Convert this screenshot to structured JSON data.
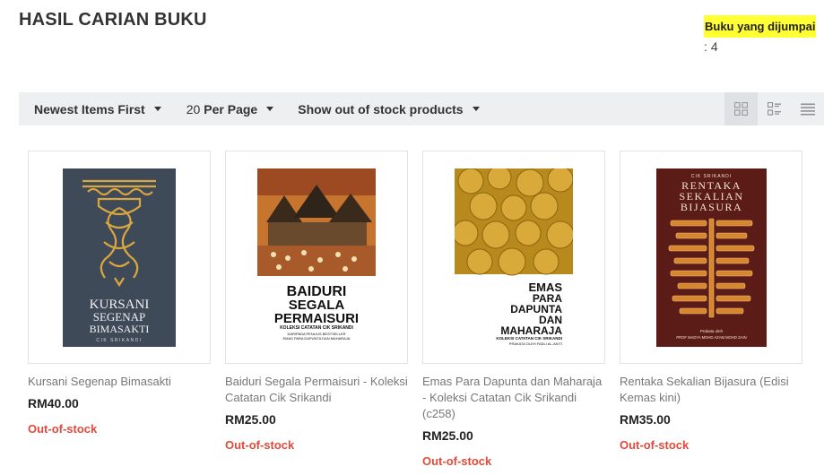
{
  "header": {
    "title": "HASIL CARIAN BUKU",
    "found_label": "Buku yang dijumpai",
    "found_count_prefix": ":",
    "found_count": "4"
  },
  "toolbar": {
    "sort_label": "Newest Items First",
    "per_page_number": "20",
    "per_page_label": "Per Page",
    "stock_label": "Show out of stock products",
    "views": [
      "grid-large-icon",
      "grid-list-icon",
      "list-icon"
    ],
    "active_view": "grid-large-icon"
  },
  "products": [
    {
      "name": "Kursani Segenap Bimasakti",
      "price": "RM40.00",
      "stock": "Out-of-stock",
      "cover": {
        "line1": "KURSANI",
        "line2": "SEGENAP",
        "line3": "BIMASAKTI",
        "sub": "CIK SRIKANDI"
      }
    },
    {
      "name": "Baiduri Segala Permaisuri - Koleksi Catatan Cik Srikandi",
      "price": "RM25.00",
      "stock": "Out-of-stock",
      "cover": {
        "line1": "BAIDURI",
        "line2": "SEGALA",
        "line3": "PERMAISURI",
        "sub": "KOLEKSI CATATAN CIK SRIKANDI",
        "sub2": "DARIPADA PENULIS BESTSELLER",
        "sub3": "EMAS PARA DAPUNTA DAN MAHARAJA"
      }
    },
    {
      "name": "Emas Para Dapunta dan Maharaja - Koleksi Catatan Cik Srikandi (c258)",
      "price": "RM25.00",
      "stock": "Out-of-stock",
      "cover": {
        "line1": "EMAS",
        "line2": "PARA",
        "line3": "DAPUNTA",
        "line4": "DAN",
        "line5": "MAHARAJA",
        "sub": "KOLEKSI CATATAN CIK SRIKANDI",
        "sub2": "PRAKATA OLEH FADLI AL-AKITI"
      }
    },
    {
      "name": "Rentaka Sekalian Bijasura (Edisi Kemas kini)",
      "price": "RM35.00",
      "stock": "Out-of-stock",
      "cover": {
        "author": "CIK SRIKANDI",
        "line1": "RENTAKA",
        "line2": "SEKALIAN",
        "line3": "BIJASURA",
        "sub": "Prakata oleh",
        "sub2": "PROF MADYA MOHD AZAM MOHD ZAIN"
      }
    }
  ]
}
